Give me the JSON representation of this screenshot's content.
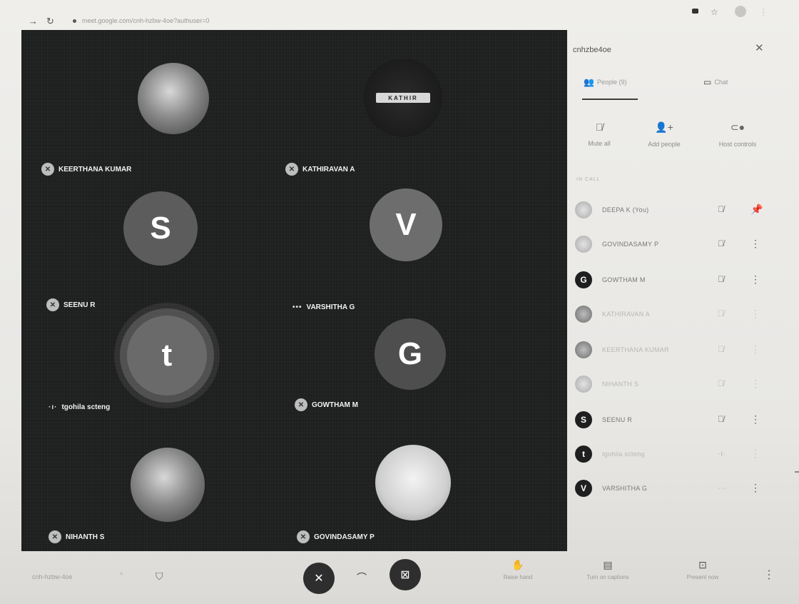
{
  "browser": {
    "url": "meet.google.com/cnh-hzbw-4oe?authuser=0"
  },
  "grid": {
    "tiles": [
      {
        "name": "KEERTHANA KUMAR",
        "avatar": "photo",
        "status": "muted"
      },
      {
        "name": "KATHIRAVAN A",
        "avatar": "logo",
        "avatar_text": "KATHIR",
        "status": "muted"
      },
      {
        "name": "SEENU R",
        "avatar": "letter",
        "letter": "S",
        "status": "muted"
      },
      {
        "name": "VARSHITHA G",
        "avatar": "letter",
        "letter": "V",
        "status": "speaking"
      },
      {
        "name": "tgohila scteng",
        "avatar": "letter",
        "letter": "t",
        "status": "speaking"
      },
      {
        "name": "GOWTHAM M",
        "avatar": "letter",
        "letter": "G",
        "status": "muted"
      },
      {
        "name": "NIHANTH S",
        "avatar": "photo",
        "status": "muted"
      },
      {
        "name": "GOVINDASAMY P",
        "avatar": "photo",
        "status": "muted"
      }
    ]
  },
  "bottom_bar": {
    "meeting_code": "cnh-hzbw-4oe",
    "raise_hand_label": "Raise hand",
    "captions_label": "Turn on captions",
    "present_label": "Present now"
  },
  "panel": {
    "title": "cnhzbe4oe",
    "people_tab": "People (9)",
    "chat_tab": "Chat",
    "mute_all": "Mute all",
    "add_people": "Add people",
    "host_controls": "Host controls",
    "section_label": "IN CALL",
    "participants": [
      {
        "name": "DEEPA K (You)",
        "avatar": "photo",
        "status": "muted"
      },
      {
        "name": "GOVINDASAMY P",
        "avatar": "photo",
        "status": "muted"
      },
      {
        "name": "GOWTHAM M",
        "avatar": "letter",
        "letter": "G",
        "status": "muted"
      },
      {
        "name": "KATHIRAVAN A",
        "avatar": "photo",
        "status": "muted"
      },
      {
        "name": "KEERTHANA KUMAR",
        "avatar": "photo",
        "status": "muted"
      },
      {
        "name": "NIHANTH S",
        "avatar": "photo",
        "status": "muted"
      },
      {
        "name": "SEENU R",
        "avatar": "letter",
        "letter": "S",
        "status": "muted"
      },
      {
        "name": "tgohila scteng",
        "avatar": "letter",
        "letter": "t",
        "status": "speaking"
      },
      {
        "name": "VARSHITHA G",
        "avatar": "letter",
        "letter": "V",
        "status": "speaking"
      }
    ]
  }
}
